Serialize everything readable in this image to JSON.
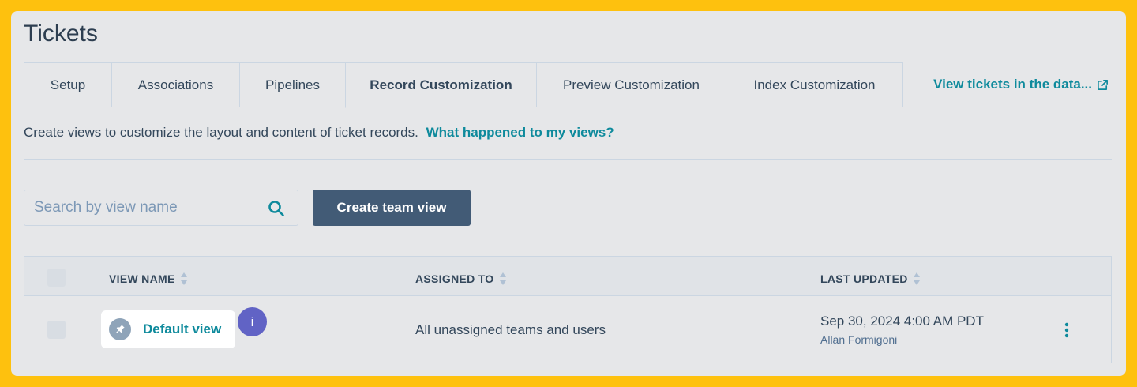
{
  "page": {
    "title": "Tickets"
  },
  "tabs": [
    {
      "label": "Setup",
      "active": false
    },
    {
      "label": "Associations",
      "active": false
    },
    {
      "label": "Pipelines",
      "active": false
    },
    {
      "label": "Record Customization",
      "active": true
    },
    {
      "label": "Preview Customization",
      "active": false
    },
    {
      "label": "Index Customization",
      "active": false
    }
  ],
  "tab_link": {
    "label": "View tickets in the data...",
    "icon": "external-link-icon"
  },
  "description": {
    "text": "Create views to customize the layout and content of ticket records.",
    "link": "What happened to my views?"
  },
  "search": {
    "placeholder": "Search by view name",
    "value": "",
    "icon": "search-icon"
  },
  "create_button": {
    "label": "Create team view"
  },
  "table": {
    "columns": [
      {
        "label": "VIEW NAME",
        "sortable": true
      },
      {
        "label": "ASSIGNED TO",
        "sortable": true
      },
      {
        "label": "LAST UPDATED",
        "sortable": true
      }
    ],
    "rows": [
      {
        "view_name": "Default view",
        "pinned": true,
        "info_badge": "i",
        "assigned_to": "All unassigned teams and users",
        "last_updated": "Sep 30, 2024 4:00 AM PDT",
        "updated_by": "Allan Formigoni"
      }
    ]
  },
  "colors": {
    "background": "#FEC10E",
    "panel": "#E6E7E9",
    "link": "#0e8a9c",
    "primary_button": "#425b76",
    "info_badge": "#6163c5"
  }
}
